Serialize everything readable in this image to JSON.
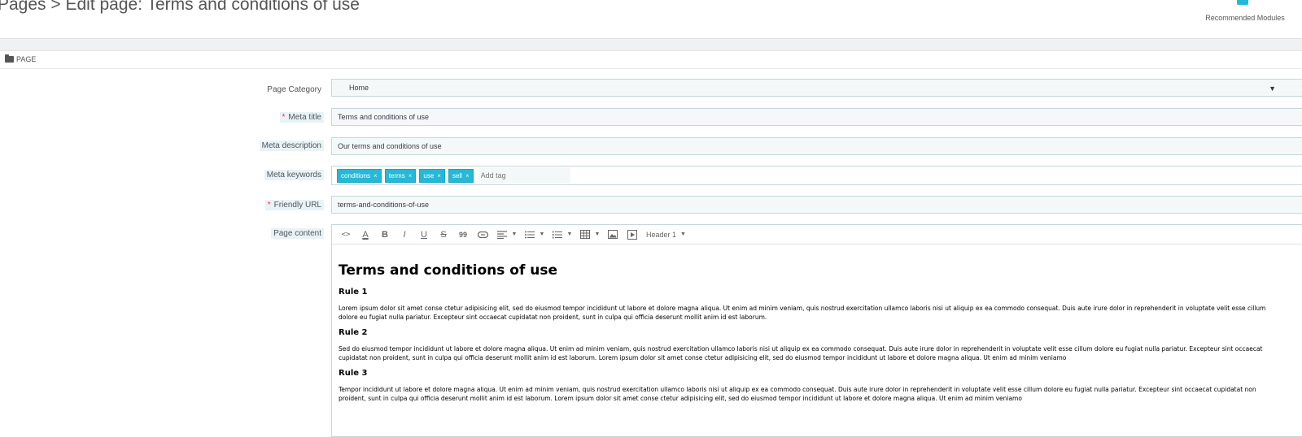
{
  "header": {
    "title": "Pages > Edit page: Terms and conditions of use",
    "recommended_modules": "Recommended Modules",
    "puzzle_icon": "puzzle-icon"
  },
  "panel": {
    "heading": "PAGE",
    "heading_icon": "folder-icon"
  },
  "form": {
    "page_category": {
      "label": "Page Category",
      "value": "Home"
    },
    "meta_title": {
      "label": "Meta title",
      "required": "*",
      "value": "Terms and conditions of use"
    },
    "meta_description": {
      "label": "Meta description",
      "value": "Our terms and conditions of use"
    },
    "meta_keywords": {
      "label": "Meta keywords",
      "tags": [
        "conditions",
        "terms",
        "use",
        "sell"
      ],
      "remove_glyph": "×",
      "placeholder": "Add tag"
    },
    "friendly_url": {
      "label": "Friendly URL",
      "required": "*",
      "value": "terms-and-conditions-of-use"
    },
    "page_content": {
      "label": "Page content"
    }
  },
  "editor": {
    "toolbar": {
      "code": "<>",
      "font_color": "A",
      "bold": "B",
      "italic": "I",
      "underline": "U",
      "strike": "S",
      "quote": "99",
      "heading_select": "Header 1"
    },
    "content": {
      "title": "Terms and conditions of use",
      "rules": [
        {
          "heading": "Rule 1",
          "text": "Lorem ipsum dolor sit amet conse ctetur adipisicing elit, sed do eiusmod tempor incididunt ut labore et dolore magna aliqua. Ut enim ad minim veniam, quis nostrud exercitation ullamco laboris nisi ut aliquip ex ea commodo consequat. Duis aute irure dolor in reprehenderit in voluptate velit esse cillum dolore eu fugiat nulla pariatur. Excepteur sint occaecat cupidatat non proident, sunt in culpa qui officia deserunt mollit anim id est laborum."
        },
        {
          "heading": "Rule 2",
          "text": "Sed do eiusmod tempor incididunt ut labore et dolore magna aliqua. Ut enim ad minim veniam, quis nostrud exercitation ullamco laboris nisi ut aliquip ex ea commodo consequat. Duis aute irure dolor in reprehenderit in voluptate velit esse cillum dolore eu fugiat nulla pariatur. Excepteur sint occaecat cupidatat non proident, sunt in culpa qui officia deserunt mollit anim id est laborum. Lorem ipsum dolor sit amet conse ctetur adipisicing elit, sed do eiusmod tempor incididunt ut labore et dolore magna aliqua. Ut enim ad minim veniamo"
        },
        {
          "heading": "Rule 3",
          "text": "Tempor incididunt ut labore et dolore magna aliqua. Ut enim ad minim veniam, quis nostrud exercitation ullamco laboris nisi ut aliquip ex ea commodo consequat. Duis aute irure dolor in reprehenderit in voluptate velit esse cillum dolore eu fugiat nulla pariatur. Excepteur sint occaecat cupidatat non proident, sunt in culpa qui officia deserunt mollit anim id est laborum. Lorem ipsum dolor sit amet conse ctetur adipisicing elit, sed do eiusmod tempor incididunt ut labore et dolore magna aliqua. Ut enim ad minim veniamo"
        }
      ]
    }
  },
  "colors": {
    "accent": "#25b9d7",
    "required": "#e03c3c",
    "field_bg": "#f5f8f9",
    "border": "#c7d6db"
  }
}
